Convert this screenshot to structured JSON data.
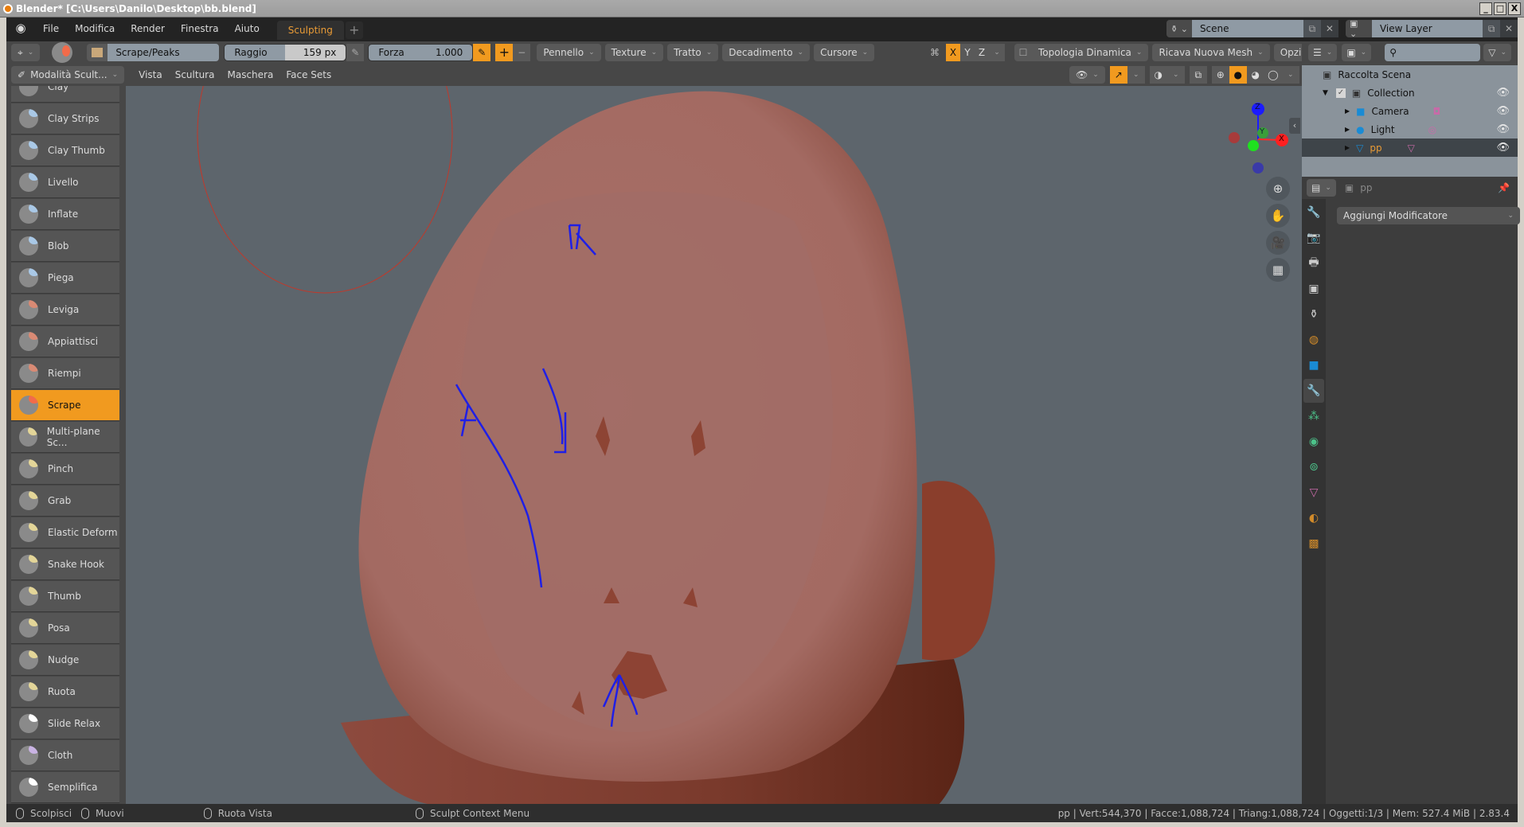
{
  "window": {
    "title": "Blender* [C:\\Users\\Danilo\\Desktop\\bb.blend]",
    "minimize": "_",
    "maximize": "□",
    "close": "X"
  },
  "topbar": {
    "menus": [
      "File",
      "Modifica",
      "Render",
      "Finestra",
      "Aiuto"
    ],
    "workspace_tab": "Sculpting",
    "add_tab": "+",
    "scene": "Scene",
    "view_layer": "View Layer"
  },
  "tool_header": {
    "brush_name": "Scrape/Peaks",
    "radius_label": "Raggio",
    "radius_value": "159 px",
    "strength_label": "Forza",
    "strength_value": "1.000",
    "add": "+",
    "subtract": "−",
    "dropdowns": [
      "Pennello",
      "Texture",
      "Tratto",
      "Decadimento",
      "Cursore"
    ],
    "symmetry_axes": [
      "X",
      "Y",
      "Z"
    ],
    "active_axis": "X",
    "right_dropdowns": [
      "Topologia Dinamica",
      "Ricava Nuova Mesh",
      "Opzioni"
    ]
  },
  "viewport_header": {
    "mode": "Modalità Scult...",
    "menus": [
      "Vista",
      "Scultura",
      "Maschera",
      "Face Sets"
    ]
  },
  "tools": [
    {
      "label": "Clay",
      "color": "#a9c8e6"
    },
    {
      "label": "Clay Strips",
      "color": "#a9c8e6"
    },
    {
      "label": "Clay Thumb",
      "color": "#a9c8e6"
    },
    {
      "label": "Livello",
      "color": "#a9c8e6"
    },
    {
      "label": "Inflate",
      "color": "#a9c8e6"
    },
    {
      "label": "Blob",
      "color": "#a9c8e6"
    },
    {
      "label": "Piega",
      "color": "#a9c8e6"
    },
    {
      "label": "Leviga",
      "color": "#d98a74"
    },
    {
      "label": "Appiattisci",
      "color": "#d98a74"
    },
    {
      "label": "Riempi",
      "color": "#d98a74"
    },
    {
      "label": "Scrape",
      "color": "#f26b4a",
      "active": true
    },
    {
      "label": "Multi-plane Sc...",
      "color": "#e3d598"
    },
    {
      "label": "Pinch",
      "color": "#e3d598"
    },
    {
      "label": "Grab",
      "color": "#e3d598"
    },
    {
      "label": "Elastic Deform",
      "color": "#e3d598"
    },
    {
      "label": "Snake Hook",
      "color": "#e3d598"
    },
    {
      "label": "Thumb",
      "color": "#e3d598"
    },
    {
      "label": "Posa",
      "color": "#e3d598"
    },
    {
      "label": "Nudge",
      "color": "#e3d598"
    },
    {
      "label": "Ruota",
      "color": "#e3d598"
    },
    {
      "label": "Slide Relax",
      "color": "#ffffff"
    },
    {
      "label": "Cloth",
      "color": "#c9b3e3"
    },
    {
      "label": "Semplifica",
      "color": "#ffffff"
    }
  ],
  "gizmo": {
    "x": "X",
    "y": "Y",
    "z": "Z"
  },
  "outliner": {
    "root": "Raccolta Scena",
    "items": [
      {
        "label": "Collection",
        "icon": "collection-icon"
      },
      {
        "label": "Camera",
        "icon": "camera-icon"
      },
      {
        "label": "Light",
        "icon": "light-icon"
      },
      {
        "label": "pp",
        "icon": "mesh-icon",
        "selected": true
      }
    ]
  },
  "properties": {
    "object_name": "pp",
    "add_modifier": "Aggiungi Modificatore",
    "active_tab": "modifier-icon"
  },
  "statusbar": {
    "left_click": "Scolpisci",
    "drag": "Muovi",
    "middle": "Ruota Vista",
    "right": "Sculpt Context Menu",
    "stats": "pp | Vert:544,370 | Facce:1,088,724 | Triang:1,088,724 | Oggetti:1/3 | Mem: 527.4 MiB | 2.83.4"
  },
  "colors": {
    "accent": "#f19a1f",
    "mesh": "#a96a62",
    "viewport_bg": "#5d656c",
    "annotation": "#1f1fe6"
  }
}
